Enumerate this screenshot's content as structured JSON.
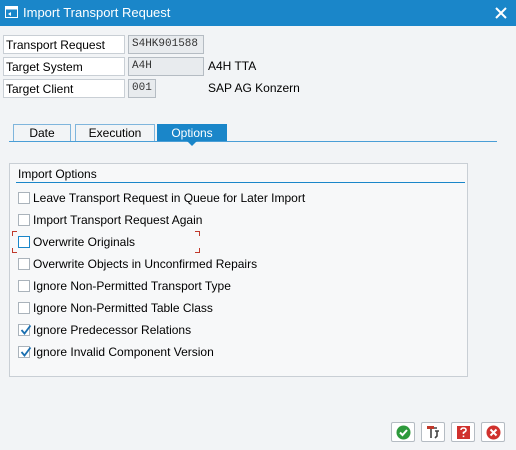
{
  "window": {
    "title": "Import Transport Request",
    "title_icon": "window-icon",
    "close_icon": "close-icon"
  },
  "fields": {
    "transport_request": {
      "label": "Transport Request",
      "value": "S4HK901588"
    },
    "target_system": {
      "label": "Target System",
      "value": "A4H",
      "description": "A4H TTA"
    },
    "target_client": {
      "label": "Target Client",
      "value": "001",
      "description": "SAP AG Konzern"
    }
  },
  "tabs": [
    {
      "label": "Date",
      "active": false
    },
    {
      "label": "Execution",
      "active": false
    },
    {
      "label": "Options",
      "active": true
    }
  ],
  "options_group": {
    "title": "Import Options",
    "checkboxes": [
      {
        "label": "Leave Transport Request in Queue for Later Import",
        "checked": false
      },
      {
        "label": "Import Transport Request Again",
        "checked": false
      },
      {
        "label": "Overwrite Originals",
        "checked": false,
        "focused": true
      },
      {
        "label": "Overwrite Objects in Unconfirmed Repairs",
        "checked": false
      },
      {
        "label": "Ignore Non-Permitted Transport Type",
        "checked": false
      },
      {
        "label": "Ignore Non-Permitted Table Class",
        "checked": false
      },
      {
        "label": "Ignore Predecessor Relations",
        "checked": true
      },
      {
        "label": "Ignore Invalid Component Version",
        "checked": true
      }
    ]
  },
  "footer_buttons": [
    {
      "icon": "confirm-check-icon"
    },
    {
      "icon": "execute-icon"
    },
    {
      "icon": "help-icon"
    },
    {
      "icon": "cancel-icon"
    }
  ],
  "colors": {
    "accent": "#1a86c9",
    "confirm": "#2e9a3c",
    "cancel": "#d0312d",
    "checkmark": "#1a6fb0"
  }
}
